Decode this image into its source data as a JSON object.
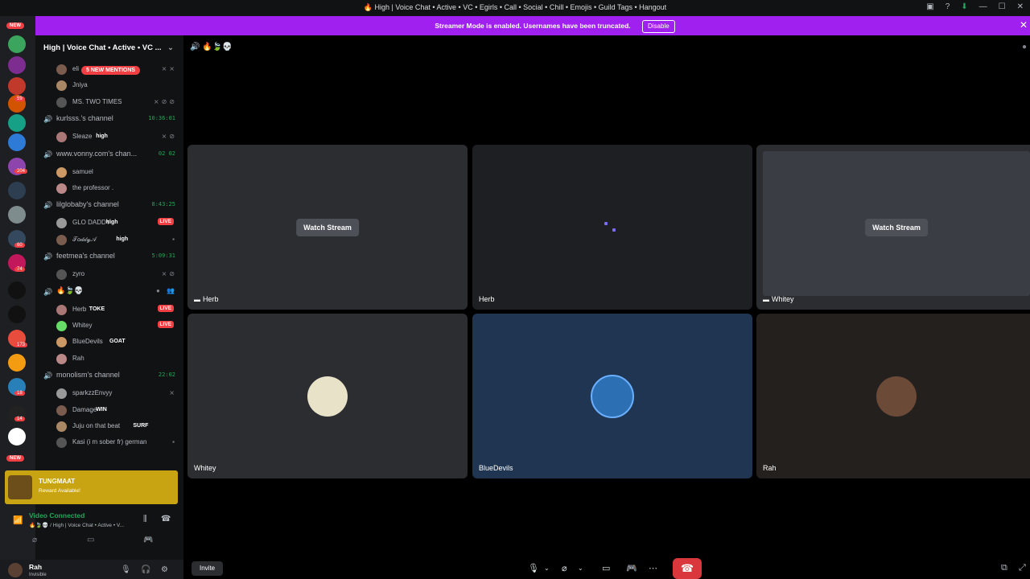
{
  "window": {
    "title": "🔥 High | Voice Chat • Active • VC • Egirls • Call • Social • Chill • Emojis • Guild Tags • Hangout",
    "icons": [
      "screen-share-icon",
      "help-icon",
      "download-icon",
      "minimize-icon",
      "maximize-icon",
      "close-icon"
    ]
  },
  "banner": {
    "text": "Streamer Mode is enabled. Usernames have been truncated.",
    "button": "Disable"
  },
  "server_rail": {
    "badges": [
      "NEW",
      "59",
      "204",
      "60",
      "74",
      "173",
      "18",
      "14",
      "NEW"
    ]
  },
  "sidebar": {
    "server_name": "High | Voice Chat • Active • VC ...",
    "mentions_pill": "5 NEW MENTIONS",
    "rows": [
      {
        "kind": "user",
        "name": "eli",
        "icons": "⨯⨯"
      },
      {
        "kind": "user",
        "name": "Jniya",
        "icons": ""
      },
      {
        "kind": "user",
        "name": "MS. TWO TIMES",
        "icons": "⨯⊘⊘"
      },
      {
        "kind": "channel",
        "name": "kurlsss.'s channel",
        "timer": "10:36:01"
      },
      {
        "kind": "user",
        "name": "Sleaze",
        "tag": "high",
        "icons": "⨯⊘"
      },
      {
        "kind": "channel",
        "name": "www.vonny.com's chan...",
        "timer": "02 02"
      },
      {
        "kind": "user",
        "name": "samuel",
        "icons": ""
      },
      {
        "kind": "user",
        "name": "the professor .",
        "icons": ""
      },
      {
        "kind": "channel",
        "name": "lilglobaby's channel",
        "timer": "8:43:25"
      },
      {
        "kind": "user",
        "name": "GLO DADDY",
        "tag": "high",
        "live": "LIVE"
      },
      {
        "kind": "user",
        "name": "𝒯𝑜𝒹𝒹𝓎𝒜",
        "tag": "high",
        "icons": "▪"
      },
      {
        "kind": "channel",
        "name": "feetmea's channel",
        "timer": "5:09:31"
      },
      {
        "kind": "user",
        "name": "zyro",
        "icons": "⨯⊘"
      },
      {
        "kind": "channel",
        "name": "🔥🍃💀",
        "timer": ""
      },
      {
        "kind": "user",
        "name": "Herb",
        "tag": "TOKE",
        "live": "LIVE"
      },
      {
        "kind": "user",
        "name": "Whitey",
        "tag": "",
        "live": "LIVE"
      },
      {
        "kind": "user",
        "name": "BlueDevils",
        "tag": "GOAT"
      },
      {
        "kind": "user",
        "name": "Rah"
      },
      {
        "kind": "channel",
        "name": "monolism's channel",
        "timer": "22:02"
      },
      {
        "kind": "user",
        "name": "sparkzzEnvyy",
        "icons": "⨯"
      },
      {
        "kind": "user",
        "name": "Damage",
        "tag": "WIN"
      },
      {
        "kind": "user",
        "name": "Juju on that beat",
        "tag": "SURF"
      },
      {
        "kind": "user",
        "name": "Kasi (i m sober fr) german",
        "icons": "▪"
      }
    ]
  },
  "promo": {
    "title": "TUNGMAAT",
    "subtitle": "Reward Available!"
  },
  "voice": {
    "status": "Video Connected",
    "channel": "🔥🍃💀 / High | Voice Chat • Active • V..."
  },
  "user": {
    "name": "Rah",
    "status": "Invisible"
  },
  "stage": {
    "header_emojis": "🔊 🔥🍃💀",
    "tiles": [
      {
        "name": "Herb",
        "watch": "Watch Stream",
        "screen": true
      },
      {
        "name": "Herb",
        "watch": "",
        "screen": false
      },
      {
        "name": "Whitey",
        "watch": "Watch Stream",
        "screen": true
      },
      {
        "name": "Whitey",
        "watch": "",
        "screen": false
      },
      {
        "name": "BlueDevils",
        "watch": "",
        "screen": false
      },
      {
        "name": "Rah",
        "watch": "",
        "screen": false
      }
    ]
  },
  "controls": {
    "invite": "Invite"
  },
  "colors": {
    "accent": "#a020f0",
    "live": "#f23f43",
    "connected": "#23a55a",
    "hangup": "#da373c"
  }
}
